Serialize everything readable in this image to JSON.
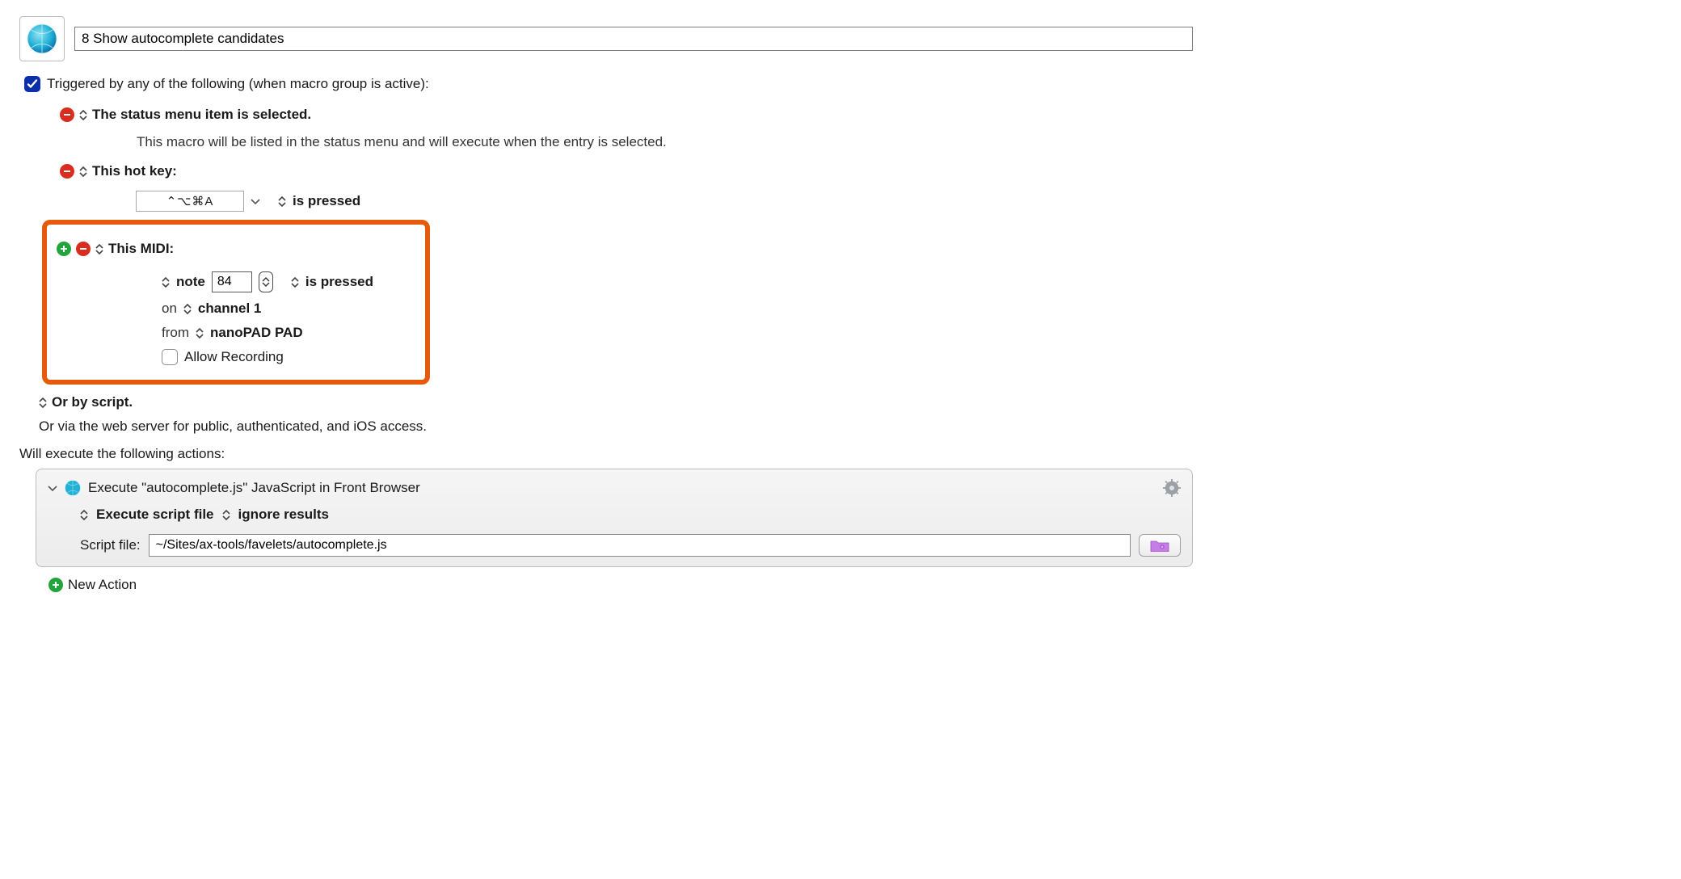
{
  "header": {
    "title_value": "8 Show autocomplete candidates"
  },
  "triggered_label": "Triggered by any of the following (when macro group is active):",
  "trigger1": {
    "label": "The status menu item is selected.",
    "sub": "This macro will be listed in the status menu and will execute when the entry is selected."
  },
  "trigger2": {
    "label": "This hot key:",
    "hotkey": "⌃⌥⌘A",
    "state": "is pressed"
  },
  "trigger3": {
    "label": "This MIDI:",
    "note_label": "note",
    "note_value": "84",
    "note_state": "is pressed",
    "on_label": "on",
    "channel": "channel 1",
    "from_label": "from",
    "device": "nanoPAD PAD",
    "allow_rec": "Allow Recording"
  },
  "or_script": "Or by script.",
  "or_web": "Or via the web server for public, authenticated, and iOS access.",
  "exec_header": "Will execute the following actions:",
  "action": {
    "title": "Execute \"autocomplete.js\" JavaScript in Front Browser",
    "mode": "Execute script file",
    "results": "ignore results",
    "file_label": "Script file:",
    "file_path": "~/Sites/ax-tools/favelets/autocomplete.js"
  },
  "new_action": "New Action"
}
